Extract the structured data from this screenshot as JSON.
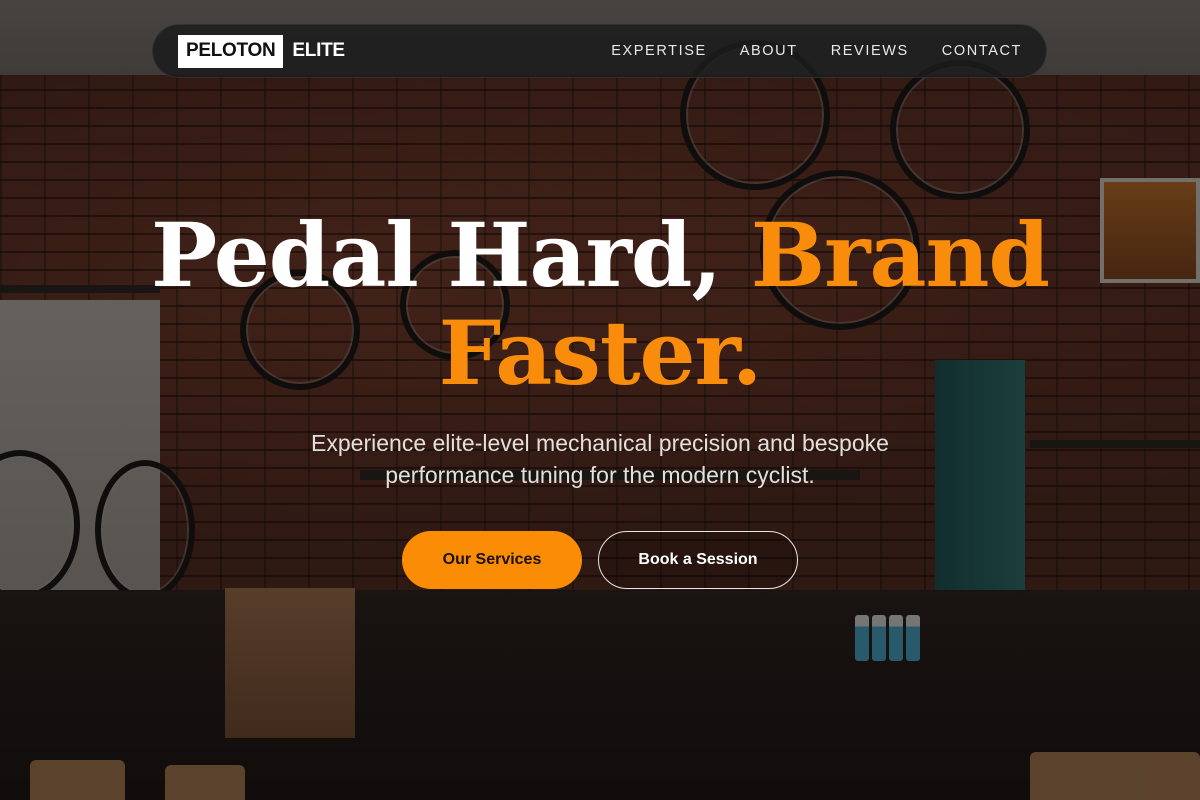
{
  "brand": {
    "logo_box": "PELOTON",
    "logo_text": "ELITE"
  },
  "nav": {
    "items": [
      "EXPERTISE",
      "ABOUT",
      "REVIEWS",
      "CONTACT"
    ]
  },
  "hero": {
    "title_main": "Pedal Hard,",
    "title_accent_1": "Brand",
    "title_accent_2": "Faster.",
    "subtitle_line1": "Experience elite-level mechanical precision and bespoke",
    "subtitle_line2": "performance tuning for the modern cyclist.",
    "primary_button": "Our Services",
    "secondary_button": "Book a Session"
  },
  "colors": {
    "accent": "#f98c0b",
    "nav_bg": "#1c1c1c",
    "text": "#ffffff"
  },
  "background": {
    "icon": "bike-shop-photo"
  }
}
